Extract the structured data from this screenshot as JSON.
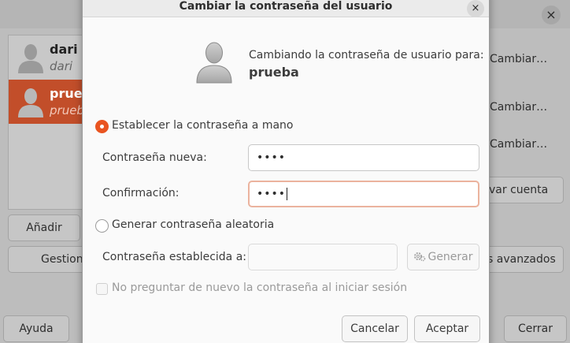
{
  "background": {
    "close_glyph": "×",
    "users": [
      {
        "name": "dari",
        "subtitle": "dari"
      },
      {
        "name": "prueb",
        "subtitle": "prueb"
      }
    ],
    "row_buttons": [
      "Cambiar…",
      "Cambiar…",
      "Cambiar…"
    ],
    "remove_button": "var cuenta",
    "add_button": "Añadir",
    "manage_button": "Gestion",
    "advanced_button": "s avanzados",
    "help_button": "Ayuda",
    "close_button": "Cerrar",
    "selected_color": "#c24e2a"
  },
  "dialog": {
    "title": "Cambiar la contraseña del usuario",
    "close_glyph": "×",
    "changing_label": "Cambiando la contraseña de usuario para:",
    "username": "prueba",
    "option_manual": "Establecer la contraseña a mano",
    "new_password_label": "Contraseña nueva:",
    "new_password_value": "••••",
    "confirm_label": "Confirmación:",
    "confirm_value": "••••",
    "option_random": "Generar contraseña aleatoria",
    "set_password_label": "Contraseña establecida a:",
    "set_password_value": "",
    "generate_button": "Generar",
    "dont_ask_label": "No preguntar de nuevo la contraseña al iniciar sesión",
    "cancel_button": "Cancelar",
    "accept_button": "Aceptar",
    "accent_color": "#e95420"
  }
}
